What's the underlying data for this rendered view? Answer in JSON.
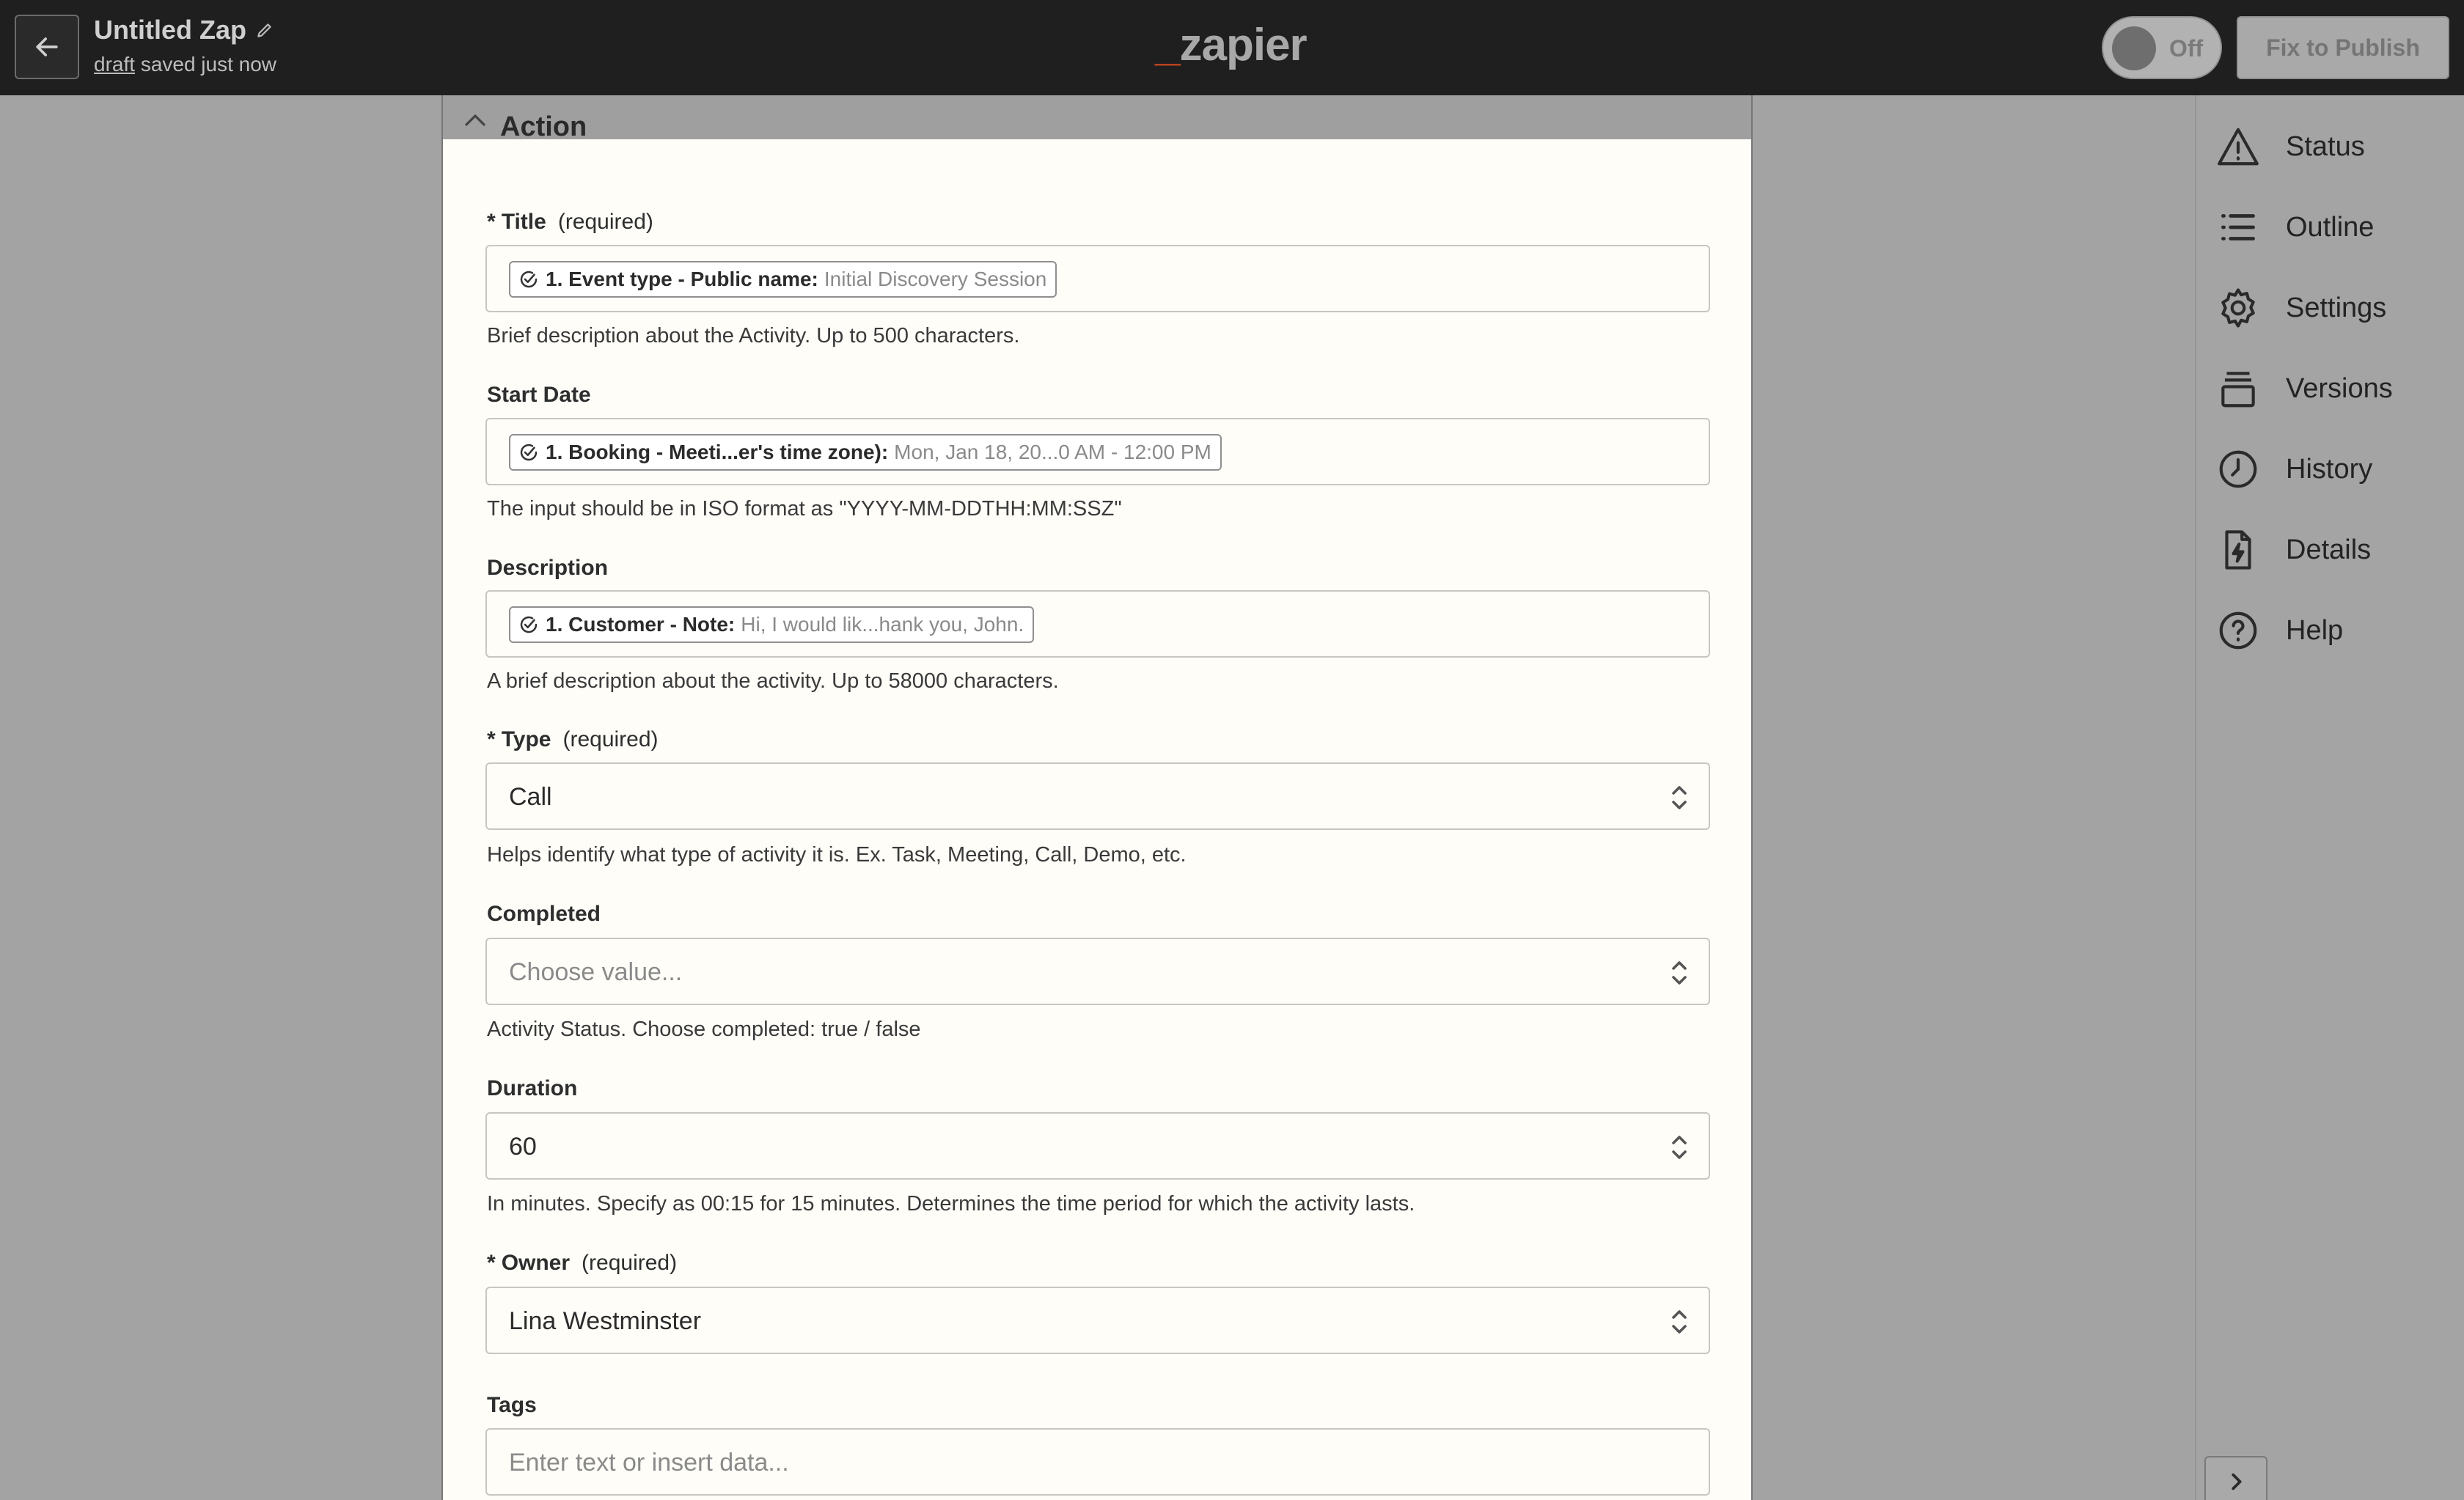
{
  "header": {
    "zap_name": "Untitled Zap",
    "status_link": "draft",
    "status_rest": "saved just now",
    "logo_text": "zapier",
    "toggle_label": "Off",
    "publish_label": "Fix to Publish"
  },
  "sidebar": {
    "items": [
      {
        "label": "Status",
        "icon": "warning-icon"
      },
      {
        "label": "Outline",
        "icon": "list-icon"
      },
      {
        "label": "Settings",
        "icon": "gear-icon"
      },
      {
        "label": "Versions",
        "icon": "stack-icon"
      },
      {
        "label": "History",
        "icon": "clock-icon"
      },
      {
        "label": "Details",
        "icon": "file-bolt-icon"
      },
      {
        "label": "Help",
        "icon": "help-icon"
      }
    ]
  },
  "panel": {
    "section_title": "Action",
    "fields": {
      "title": {
        "star": "*",
        "label": "Title",
        "required": "(required)",
        "pill_key": "1. Event type - Public name:",
        "pill_value": "Initial Discovery Session",
        "help": "Brief description about the Activity. Up to 500 characters."
      },
      "start_date": {
        "label": "Start Date",
        "pill_key": "1. Booking - Meeti...er's time zone):",
        "pill_value": "Mon, Jan 18, 20...0 AM - 12:00 PM",
        "help": "The input should be in ISO format as \"YYYY-MM-DDTHH:MM:SSZ\""
      },
      "description": {
        "label": "Description",
        "pill_key": "1. Customer - Note:",
        "pill_value": "Hi, I would lik...hank you, John.",
        "help": "A brief description about the activity. Up to 58000 characters."
      },
      "type": {
        "star": "*",
        "label": "Type",
        "required": "(required)",
        "value": "Call",
        "help": "Helps identify what type of activity it is. Ex. Task, Meeting, Call, Demo, etc."
      },
      "completed": {
        "label": "Completed",
        "placeholder": "Choose value...",
        "help": "Activity Status. Choose completed: true / false"
      },
      "duration": {
        "label": "Duration",
        "value": "60",
        "help": "In minutes. Specify as 00:15 for 15 minutes. Determines the time period for which the activity lasts."
      },
      "owner": {
        "star": "*",
        "label": "Owner",
        "required": "(required)",
        "value": "Lina Westminster"
      },
      "tags": {
        "label": "Tags",
        "placeholder": "Enter text or insert data..."
      }
    }
  },
  "colors": {
    "topbar": "#1f1f1f",
    "overlay": "#a3a3a3",
    "panel_bg": "#fffdf8",
    "logo_dash": "#c0451e"
  }
}
